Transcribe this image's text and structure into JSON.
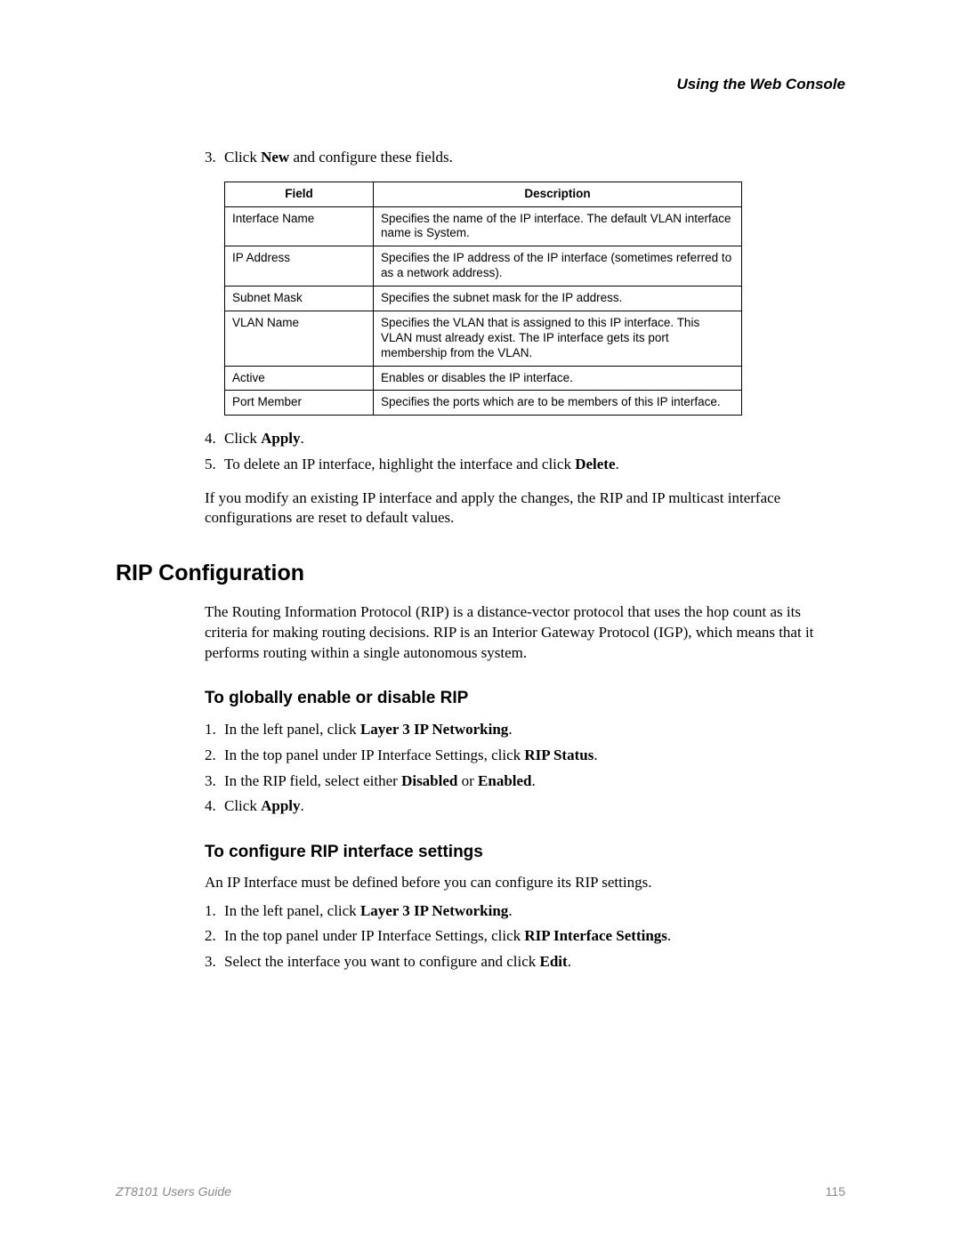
{
  "header": {
    "right": "Using the Web Console"
  },
  "stepsA": [
    {
      "num": "3.",
      "pre": "Click ",
      "bold": "New",
      "post": " and configure these fields."
    }
  ],
  "table": {
    "head": {
      "field": "Field",
      "desc": "Description"
    },
    "rows": [
      {
        "field": "Interface Name",
        "desc": "Specifies the name of the IP interface. The default VLAN interface name is System."
      },
      {
        "field": "IP Address",
        "desc": "Specifies the IP address of the IP interface (sometimes referred to as a network address)."
      },
      {
        "field": "Subnet Mask",
        "desc": "Specifies the subnet mask for the IP address."
      },
      {
        "field": "VLAN Name",
        "desc": "Specifies the VLAN that is assigned to this IP interface. This VLAN must already exist. The IP interface gets its port membership from the VLAN."
      },
      {
        "field": "Active",
        "desc": "Enables or disables the IP interface."
      },
      {
        "field": "Port Member",
        "desc": "Specifies the ports which are to be members of this IP interface."
      }
    ]
  },
  "stepsB": [
    {
      "num": "4.",
      "pre": "Click ",
      "bold": "Apply",
      "post": "."
    },
    {
      "num": "5.",
      "pre": "To delete an IP interface, highlight the interface and click ",
      "bold": "Delete",
      "post": "."
    }
  ],
  "paraAfterTable": "If you modify an existing IP interface and apply the changes, the RIP and IP multicast interface configurations are reset to default values.",
  "sectionTitle": "RIP Configuration",
  "ripIntro": "The Routing Information Protocol (RIP) is a distance-vector protocol that uses the hop count as its criteria for making routing decisions. RIP is an Interior Gateway Protocol (IGP), which means that it performs routing within a single autonomous system.",
  "sub1Title": "To globally enable or disable RIP",
  "sub1Steps": [
    {
      "num": "1.",
      "pre": "In the left panel, click ",
      "bold": "Layer 3 IP Networking",
      "post": "."
    },
    {
      "num": "2.",
      "pre": "In the top panel under IP Interface Settings, click ",
      "bold": "RIP Status",
      "post": "."
    },
    {
      "num": "3.",
      "pre": "In the RIP field, select either ",
      "bold": "Disabled",
      "mid": " or ",
      "bold2": "Enabled",
      "post": "."
    },
    {
      "num": "4.",
      "pre": "Click ",
      "bold": "Apply",
      "post": "."
    }
  ],
  "sub2Title": "To configure RIP interface settings",
  "sub2Intro": "An IP Interface must be defined before you can configure its RIP settings.",
  "sub2Steps": [
    {
      "num": "1.",
      "pre": "In the left panel, click ",
      "bold": "Layer 3 IP Networking",
      "post": "."
    },
    {
      "num": "2.",
      "pre": "In the top panel under IP Interface Settings, click ",
      "bold": "RIP Interface Settings",
      "post": "."
    },
    {
      "num": "3.",
      "pre": "Select the interface you want to configure and click ",
      "bold": "Edit",
      "post": "."
    }
  ],
  "footer": {
    "guide": "ZT8101 Users Guide",
    "page": "115"
  }
}
